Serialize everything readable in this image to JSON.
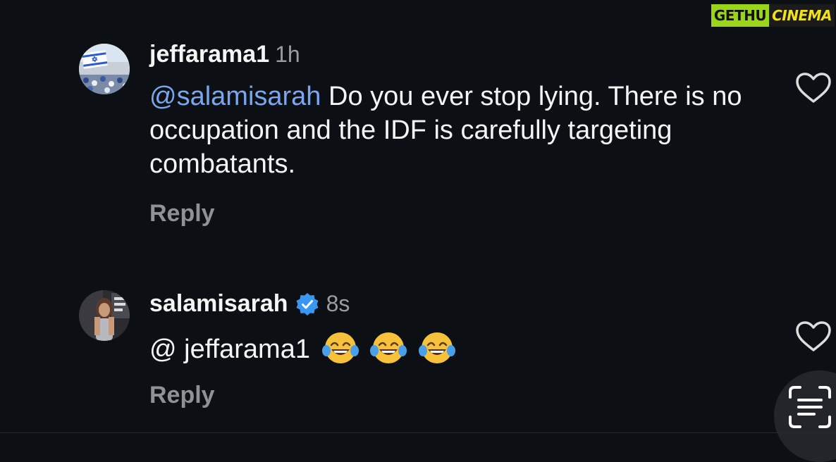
{
  "watermark": {
    "part1": "GETHU",
    "part2": "CINEMA"
  },
  "comments": [
    {
      "username": "jeffarama1",
      "time": "1h",
      "mention": "@salamisarah",
      "text": " Do you ever stop lying. There is no occupation and the IDF is carefully targeting combatants.",
      "reply_label": "Reply",
      "verified": false
    },
    {
      "username": "salamisarah",
      "time": "8s",
      "mention": "",
      "text": "@ jeffarama1",
      "emojis": [
        "face-with-tears-of-joy",
        "face-with-tears-of-joy",
        "face-with-tears-of-joy"
      ],
      "reply_label": "Reply",
      "verified": true
    }
  ],
  "icons": {
    "like": "heart-outline-icon",
    "verified": "verified-badge-icon",
    "text_scan": "text-scan-icon"
  },
  "colors": {
    "background": "#0c0f14",
    "mention": "#7aa6f0",
    "secondary_text": "#9a9ca3",
    "verified": "#3897f0"
  }
}
